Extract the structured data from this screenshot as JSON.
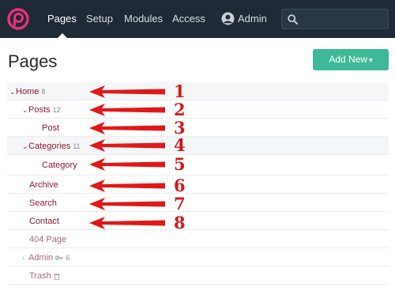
{
  "nav": {
    "items": [
      {
        "label": "Pages",
        "active": true
      },
      {
        "label": "Setup",
        "active": false
      },
      {
        "label": "Modules",
        "active": false
      },
      {
        "label": "Access",
        "active": false
      }
    ],
    "user_label": "Admin",
    "search_placeholder": "",
    "logo_icon": "processwire-logo-icon"
  },
  "header": {
    "title": "Pages",
    "add_new_label": "Add New",
    "add_new_caret": "▾"
  },
  "tree": [
    {
      "label": "Home",
      "count": "8",
      "expanded": true,
      "level": 0
    },
    {
      "label": "Posts",
      "count": "12",
      "expanded": true,
      "level": 1
    },
    {
      "label": "Post",
      "count": "",
      "level": 2
    },
    {
      "label": "Categories",
      "count": "11",
      "expanded": true,
      "level": 1
    },
    {
      "label": "Category",
      "count": "",
      "level": 2
    },
    {
      "label": "Archive",
      "count": "",
      "level": 1
    },
    {
      "label": "Search",
      "count": "",
      "level": 1
    },
    {
      "label": "Contact",
      "count": "",
      "level": 1
    },
    {
      "label": "404 Page",
      "count": "",
      "level": 1,
      "hidden": true
    },
    {
      "label": "Admin",
      "count": "6",
      "level": 1,
      "locked": true,
      "collapsed": true
    },
    {
      "label": "Trash",
      "count": "",
      "level": 1,
      "trash": true
    }
  ],
  "annotations": {
    "numbers": [
      "1",
      "2",
      "3",
      "4",
      "5",
      "6",
      "7",
      "8"
    ],
    "arrow_color": "#e01818"
  },
  "colors": {
    "nav_bg": "#1e2a35",
    "accent": "#3eb998",
    "page_link": "#8a1a30",
    "logo": "#e8317a"
  }
}
